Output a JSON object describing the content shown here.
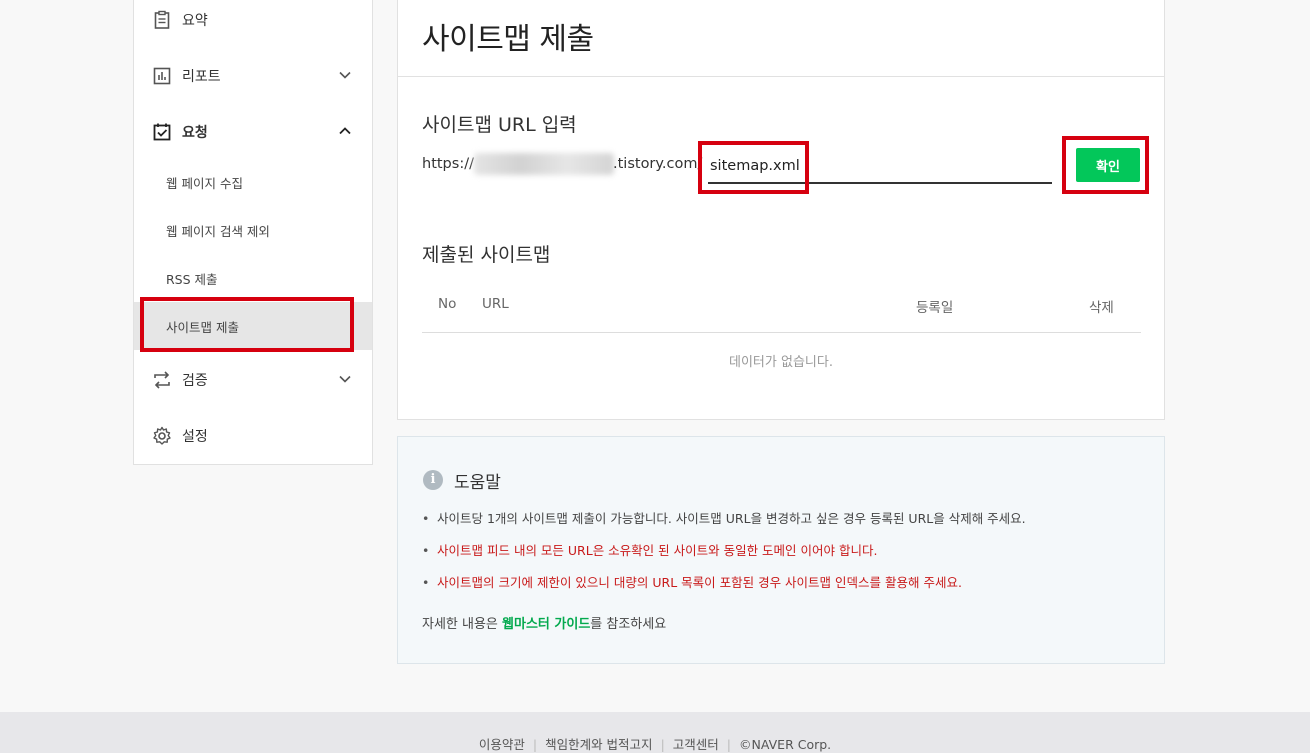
{
  "sidebar": {
    "items": [
      {
        "label": "요약",
        "icon": "clipboard-icon"
      },
      {
        "label": "리포트",
        "icon": "bar-chart-icon"
      },
      {
        "label": "요청",
        "icon": "checklist-icon"
      },
      {
        "label": "검증",
        "icon": "repeat-icon"
      },
      {
        "label": "설정",
        "icon": "gear-icon"
      }
    ],
    "sub_items": [
      "웹 페이지 수집",
      "웹 페이지 검색 제외",
      "RSS 제출",
      "사이트맵 제출"
    ]
  },
  "main": {
    "title": "사이트맵 제출",
    "url_section_title": "사이트맵 URL 입력",
    "url_prefix": "https://",
    "url_suffix": ".tistory.com/",
    "url_input_value": "sitemap.xml",
    "confirm_label": "확인",
    "submitted_title": "제출된 사이트맵",
    "table": {
      "headers": [
        "No",
        "URL",
        "등록일",
        "삭제"
      ],
      "empty_message": "데이터가 없습니다."
    }
  },
  "help": {
    "title": "도움말",
    "items": [
      "사이트당 1개의 사이트맵 제출이 가능합니다. 사이트맵 URL을 변경하고 싶은 경우 등록된 URL을 삭제해 주세요.",
      "사이트맵 피드 내의 모든 URL은 소유확인 된 사이트와 동일한 도메인 이어야 합니다.",
      "사이트맵의 크기에 제한이 있으니 대량의 URL 목록이 포함된 경우 사이트맵 인덱스를 활용해 주세요."
    ],
    "footer_prefix": "자세한 내용은 ",
    "footer_link": "웹마스터 가이드",
    "footer_suffix": "를 참조하세요"
  },
  "footer": {
    "links": [
      "이용약관",
      "책임한계와 법적고지",
      "고객센터"
    ],
    "copyright": "©NAVER Corp."
  },
  "colors": {
    "accent": "#03c75a",
    "warning_text": "#c81a1a",
    "highlight_box": "#d6000f"
  }
}
